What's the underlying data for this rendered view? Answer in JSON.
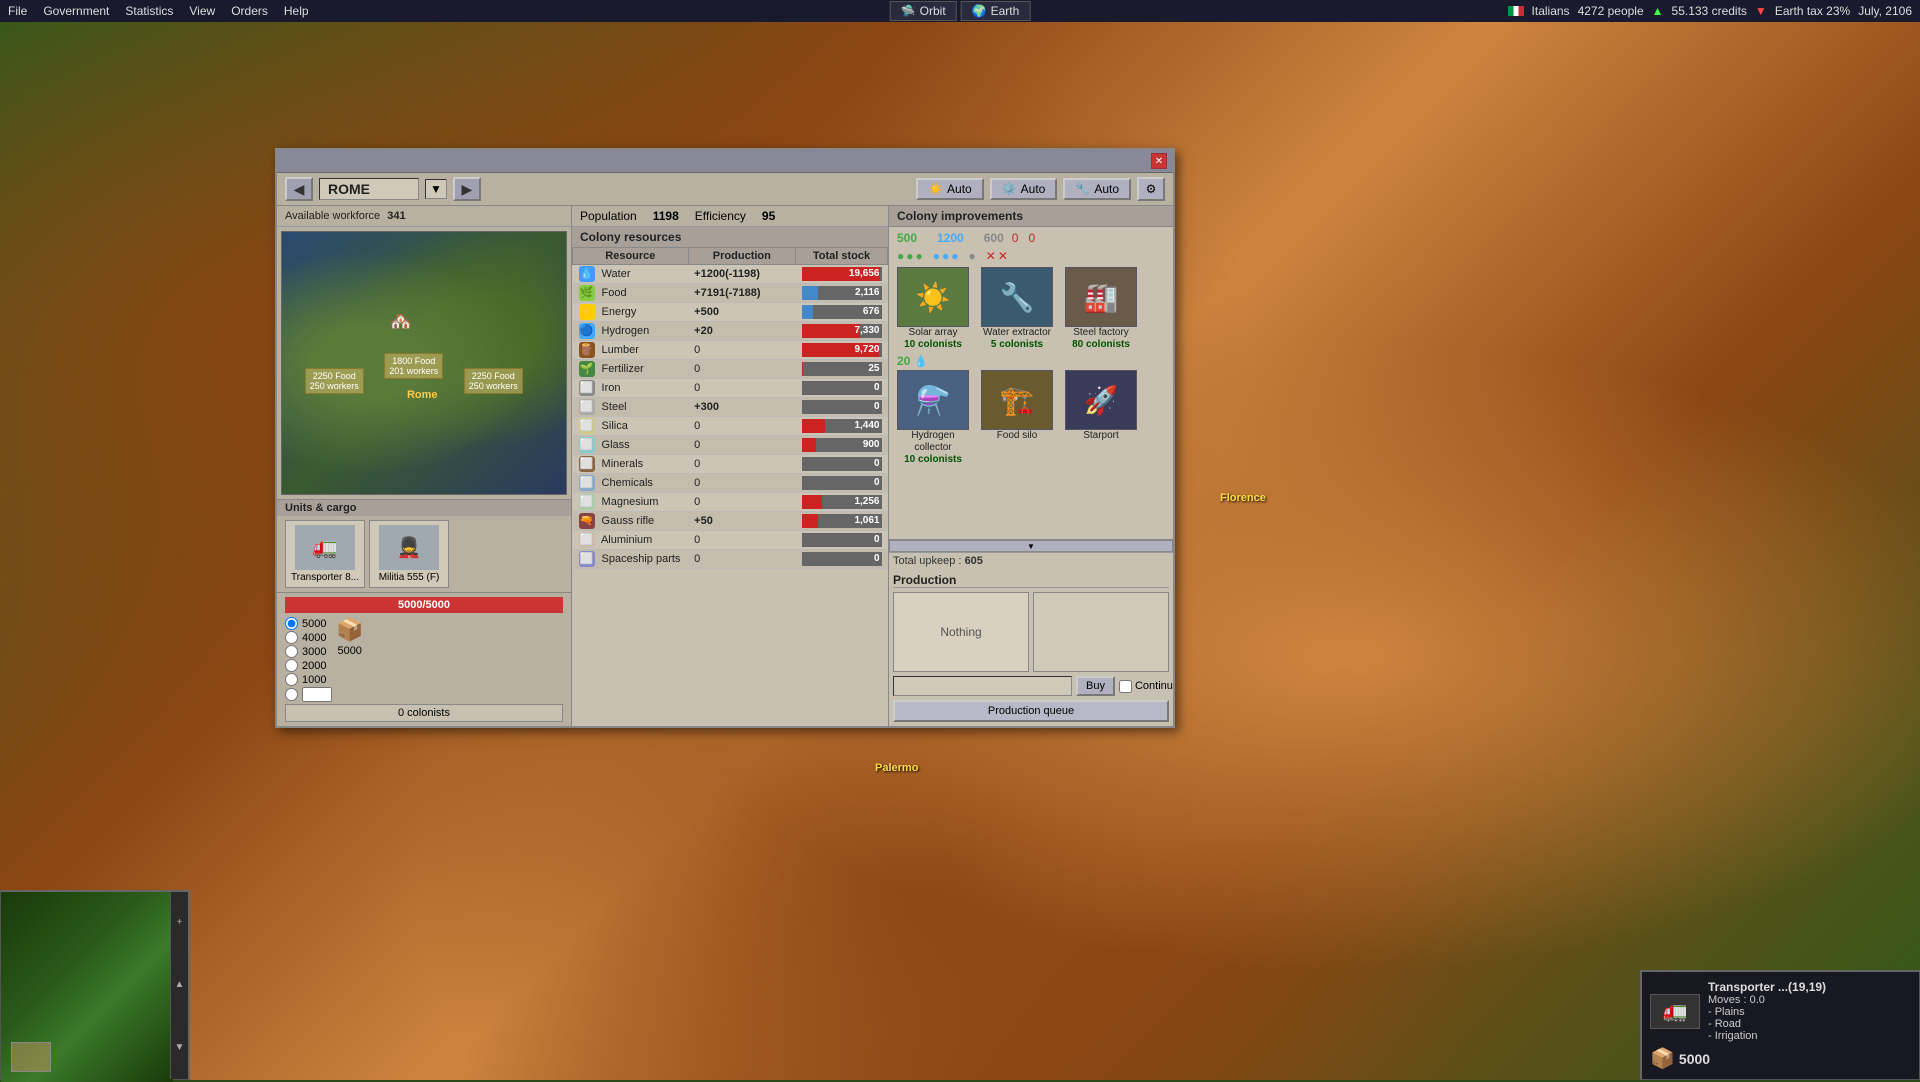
{
  "topbar": {
    "menu_items": [
      "File",
      "Government",
      "Statistics",
      "View",
      "Orders",
      "Help"
    ],
    "orbit_label": "Orbit",
    "earth_label": "Earth",
    "nation_label": "Italians",
    "population": "4272 people",
    "credits": "55.133 credits",
    "tax_label": "Earth tax 23%",
    "date": "July, 2106"
  },
  "dialog": {
    "title": "",
    "city_name": "ROME",
    "auto_labels": [
      "Auto",
      "Auto",
      "Auto"
    ],
    "population_label": "Population",
    "population_value": "1198",
    "efficiency_label": "Efficiency",
    "efficiency_value": "95",
    "available_workforce_label": "Available workforce",
    "available_workforce_value": "341"
  },
  "resources": [
    {
      "name": "Water",
      "production": "+1200(-1198)",
      "positive": true,
      "stock": 19656,
      "max_stock": 20000,
      "bar_type": "red",
      "bar_pct": 98
    },
    {
      "name": "Food",
      "production": "+7191(-7188)",
      "positive": true,
      "stock": 2116,
      "max_stock": 10000,
      "bar_type": "blue",
      "bar_pct": 21
    },
    {
      "name": "Energy",
      "production": "+500",
      "positive": true,
      "stock": 676,
      "max_stock": 5000,
      "bar_type": "blue",
      "bar_pct": 14
    },
    {
      "name": "Hydrogen",
      "production": "+20",
      "positive": true,
      "stock": 7330,
      "max_stock": 10000,
      "bar_type": "red",
      "bar_pct": 73
    },
    {
      "name": "Lumber",
      "production": "0",
      "positive": false,
      "stock": 9720,
      "max_stock": 10000,
      "bar_type": "red",
      "bar_pct": 97
    },
    {
      "name": "Fertilizer",
      "production": "0",
      "positive": false,
      "stock": 25,
      "max_stock": 5000,
      "bar_type": "red",
      "bar_pct": 1
    },
    {
      "name": "Iron",
      "production": "0",
      "positive": false,
      "stock": 0,
      "max_stock": 5000,
      "bar_type": "blue",
      "bar_pct": 0
    },
    {
      "name": "Steel",
      "production": "+300",
      "positive": true,
      "stock": 0,
      "max_stock": 5000,
      "bar_type": "blue",
      "bar_pct": 0
    },
    {
      "name": "Silica",
      "production": "0",
      "positive": false,
      "stock": 1440,
      "max_stock": 5000,
      "bar_type": "red",
      "bar_pct": 29
    },
    {
      "name": "Glass",
      "production": "0",
      "positive": false,
      "stock": 900,
      "max_stock": 5000,
      "bar_type": "red",
      "bar_pct": 18
    },
    {
      "name": "Minerals",
      "production": "0",
      "positive": false,
      "stock": 0,
      "max_stock": 5000,
      "bar_type": "blue",
      "bar_pct": 0
    },
    {
      "name": "Chemicals",
      "production": "0",
      "positive": false,
      "stock": 0,
      "max_stock": 5000,
      "bar_type": "blue",
      "bar_pct": 0
    },
    {
      "name": "Magnesium",
      "production": "0",
      "positive": false,
      "stock": 1256,
      "max_stock": 5000,
      "bar_type": "red",
      "bar_pct": 25
    },
    {
      "name": "Gauss rifle",
      "production": "+50",
      "positive": true,
      "stock": 1061,
      "max_stock": 5000,
      "bar_type": "red",
      "bar_pct": 21
    },
    {
      "name": "Aluminium",
      "production": "0",
      "positive": false,
      "stock": 0,
      "max_stock": 5000,
      "bar_type": "blue",
      "bar_pct": 0
    },
    {
      "name": "Spaceship parts",
      "production": "0",
      "positive": false,
      "stock": 0,
      "max_stock": 5000,
      "bar_type": "blue",
      "bar_pct": 0
    }
  ],
  "improvements": [
    {
      "name": "Solar array",
      "colonists": "10 colonists",
      "icon": "☀️",
      "cost_energy": 500,
      "cost_water": 1200,
      "cost_steel": 600,
      "crosses": 0
    },
    {
      "name": "Water extractor",
      "colonists": "5 colonists",
      "icon": "🔧",
      "cost_energy": null
    },
    {
      "name": "Steel factory",
      "colonists": "80 colonists",
      "icon": "🏭",
      "note": "Steel factory colonists"
    },
    {
      "name": "Hydrogen collector",
      "colonists": "10 colonists",
      "icon": "⚗️"
    },
    {
      "name": "Food silo",
      "colonists": "",
      "icon": "🏗️"
    },
    {
      "name": "Starport",
      "colonists": "",
      "icon": "🚀"
    }
  ],
  "production": {
    "header": "Production",
    "nothing_label": "Nothing",
    "total_upkeep_label": "Total upkeep :",
    "total_upkeep_value": "605",
    "buy_label": "Buy",
    "continue_label": "Continue",
    "queue_label": "Production queue"
  },
  "units": {
    "header": "Units & cargo",
    "items": [
      {
        "name": "Transporter 8...",
        "icon": "🚛"
      },
      {
        "name": "Militia 555 (F)",
        "icon": "💂"
      }
    ]
  },
  "cargo": {
    "current": 5000,
    "max": 5000,
    "options": [
      5000,
      4000,
      3000,
      2000,
      1000
    ],
    "item_icon": "📦",
    "item_amount": 5000,
    "colonists_label": "0 colonists"
  },
  "transporter_info": {
    "title": "Transporter ...(19,19)",
    "moves_label": "Moves :",
    "moves_value": "0.0",
    "terrain": [
      "- Plains",
      "- Road",
      "- Irrigation"
    ],
    "cargo_amount": "5000"
  },
  "colony_map": {
    "tiles": [
      {
        "label": "2250 Food\n250 workers",
        "left": "10%",
        "top": "55%"
      },
      {
        "label": "1800 Food\n201 workers",
        "left": "40%",
        "top": "50%"
      },
      {
        "label": "2250 Food\n250 workers",
        "left": "68%",
        "top": "55%"
      }
    ],
    "city_label": "Rome"
  }
}
